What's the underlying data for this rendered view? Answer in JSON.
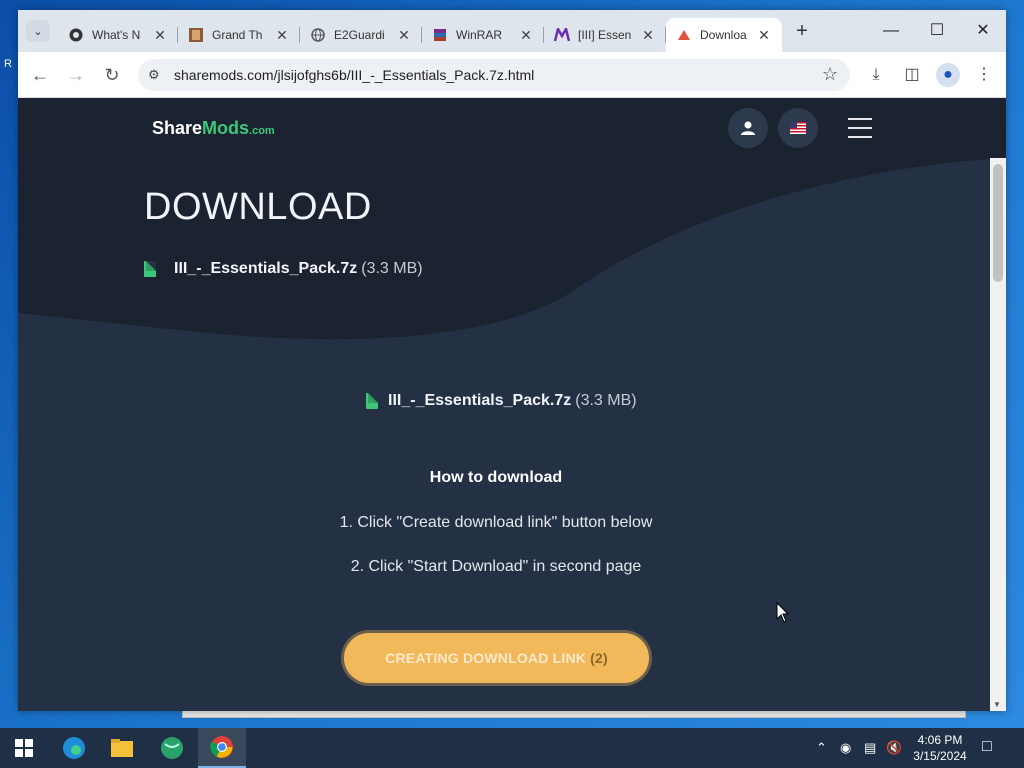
{
  "browser": {
    "tabs": [
      {
        "title": "What's N",
        "icon": "github-icon"
      },
      {
        "title": "Grand Th",
        "icon": "game-cover-icon"
      },
      {
        "title": "E2Guardi",
        "icon": "globe-icon"
      },
      {
        "title": "WinRAR",
        "icon": "winrar-icon"
      },
      {
        "title": "[III] Essen",
        "icon": "purple-m-icon"
      },
      {
        "title": "Downloa",
        "icon": "sharemods-icon",
        "active": true
      }
    ],
    "url": "sharemods.com/jlsijofghs6b/III_-_Essentials_Pack.7z.html"
  },
  "site": {
    "logo_share": "Share",
    "logo_mods": "Mods",
    "logo_com": ".com"
  },
  "page": {
    "heading": "DOWNLOAD",
    "file_name": "III_-_Essentials_Pack.7z",
    "file_size": "(3.3 MB)",
    "howto_title": "How to download",
    "step1": "1. Click \"Create download link\" button below",
    "step2": "2. Click \"Start Download\" in second page",
    "cta_label": "CREATING DOWNLOAD LINK",
    "cta_count": "(2)"
  },
  "colors": {
    "accent_green": "#3ec77a",
    "cta_orange": "#f1b95a",
    "page_bg": "#243145"
  },
  "taskbar": {
    "time": "4:06 PM",
    "date": "3/15/2024"
  }
}
